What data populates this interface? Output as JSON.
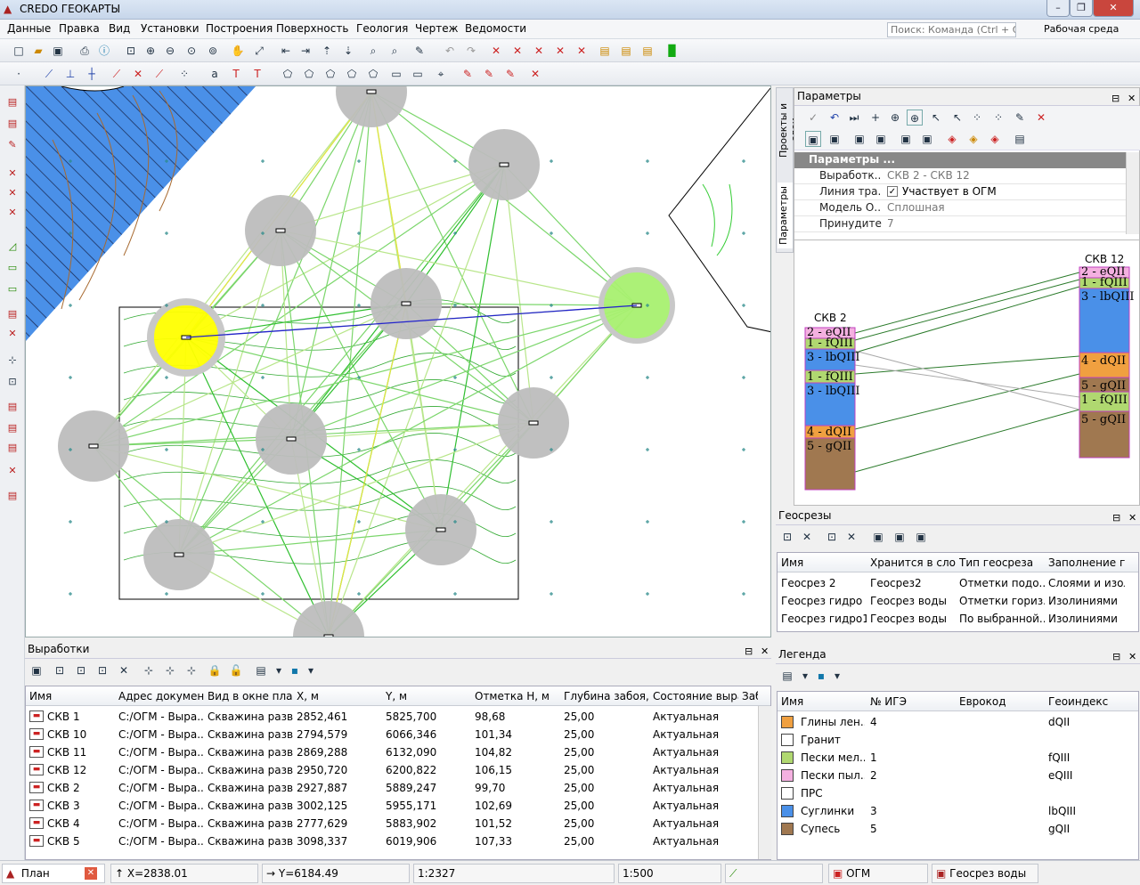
{
  "window": {
    "title": "CREDO ГЕОКАРТЫ",
    "min": "–",
    "max": "❐",
    "close": "✕"
  },
  "menu": [
    "Данные",
    "Правка",
    "Вид",
    "Установки",
    "Построения",
    "Поверхность",
    "Геология",
    "Чертеж",
    "Ведомости"
  ],
  "search": {
    "placeholder": "Поиск: Команда (Ctrl + Q)"
  },
  "workspace": "Рабочая среда",
  "side_tabs": {
    "projects": "Проекты и слои",
    "params": "Параметры"
  },
  "params_panel": {
    "title": "Параметры",
    "section": "Параметры ...",
    "rows": [
      {
        "name": "Выработк...",
        "value": "СКВ 2 - СКВ 12"
      },
      {
        "name": "Линия тра...",
        "value": "Участвует в ОГМ",
        "checked": "✓"
      },
      {
        "name": "Модель О...",
        "value": "Сплошная"
      },
      {
        "name": "Принудите...",
        "value": "7"
      }
    ]
  },
  "section_preview": {
    "left_name": "СКВ 2",
    "right_name": "СКВ 12",
    "left_layers": [
      "2 - eQII",
      "1 - fQIII",
      "3 - lbQIII",
      "1 - fQIII",
      "3 - lbQIII",
      "4 - dQII",
      "5 - gQII"
    ],
    "right_layers": [
      "2 - eQII",
      "1 - fQIII",
      "3 - lbQIII",
      "4 - dQII",
      "5 - gQII",
      "1 - fQIII",
      "5 - gQII"
    ]
  },
  "geosections": {
    "title": "Геосрезы",
    "columns": [
      "Имя",
      "Хранится в слое",
      "Тип геосреза",
      "Заполнение гео"
    ],
    "rows": [
      [
        "Геосрез 2",
        "Геосрез2",
        "Отметки подо...",
        "Слоями и изол..."
      ],
      [
        "Геосрез гидро",
        "Геосрез воды",
        "Отметки гориз...",
        "Изолиниями"
      ],
      [
        "Геосрез гидро1",
        "Геосрез воды",
        "По выбранной...",
        "Изолиниями"
      ]
    ]
  },
  "legend": {
    "title": "Легенда",
    "columns": [
      "Имя",
      "№ ИГЭ",
      "Еврокод",
      "Геоиндекс"
    ],
    "rows": [
      {
        "name": "Глины лен...",
        "ige": "4",
        "code": "",
        "index": "dQII",
        "color": "#f0a040"
      },
      {
        "name": "Гранит",
        "ige": "",
        "code": "",
        "index": "",
        "color": "#ffffff"
      },
      {
        "name": "Пески мел...",
        "ige": "1",
        "code": "",
        "index": "fQIII",
        "color": "#b0d870"
      },
      {
        "name": "Пески пыл...",
        "ige": "2",
        "code": "",
        "index": "eQIII",
        "color": "#f4b0e0"
      },
      {
        "name": "ПРС",
        "ige": "",
        "code": "",
        "index": "",
        "color": "#ffffff"
      },
      {
        "name": "Суглинки",
        "ige": "3",
        "code": "",
        "index": "lbQIII",
        "color": "#4a90e8"
      },
      {
        "name": "Супесь",
        "ige": "5",
        "code": "",
        "index": "gQII",
        "color": "#a07850"
      }
    ]
  },
  "workings": {
    "title": "Выработки",
    "columns": [
      "Имя",
      "Адрес документа",
      "Вид в окне плана",
      "X, м",
      "Y, м",
      "Отметка H, м",
      "Глубина забоя, м",
      "Состояние выра",
      "Заб"
    ],
    "rows": [
      [
        "СКВ 1",
        "С:/ОГМ - Выра...",
        "Скважина разв...",
        "2852,461",
        "5825,700",
        "98,68",
        "25,00",
        "Актуальная"
      ],
      [
        "СКВ 10",
        "С:/ОГМ - Выра...",
        "Скважина разв...",
        "2794,579",
        "6066,346",
        "101,34",
        "25,00",
        "Актуальная"
      ],
      [
        "СКВ 11",
        "С:/ОГМ - Выра...",
        "Скважина разв...",
        "2869,288",
        "6132,090",
        "104,82",
        "25,00",
        "Актуальная"
      ],
      [
        "СКВ 12",
        "С:/ОГМ - Выра...",
        "Скважина разв...",
        "2950,720",
        "6200,822",
        "106,15",
        "25,00",
        "Актуальная"
      ],
      [
        "СКВ 2",
        "С:/ОГМ - Выра...",
        "Скважина разв...",
        "2927,887",
        "5889,247",
        "99,70",
        "25,00",
        "Актуальная"
      ],
      [
        "СКВ 3",
        "С:/ОГМ - Выра...",
        "Скважина разв...",
        "3002,125",
        "5955,171",
        "102,69",
        "25,00",
        "Актуальная"
      ],
      [
        "СКВ 4",
        "С:/ОГМ - Выра...",
        "Скважина разв...",
        "2777,629",
        "5883,902",
        "101,52",
        "25,00",
        "Актуальная"
      ],
      [
        "СКВ 5",
        "С:/ОГМ - Выра...",
        "Скважина разв...",
        "3098,337",
        "6019,906",
        "107,33",
        "25,00",
        "Актуальная"
      ]
    ]
  },
  "status": {
    "tab": "План",
    "x": "X=2838.01",
    "y": "Y=6184.49",
    "scale1": "1:2327",
    "scale2": "1:500",
    "layer1": "ОГМ",
    "layer2": "Геосрез воды"
  }
}
